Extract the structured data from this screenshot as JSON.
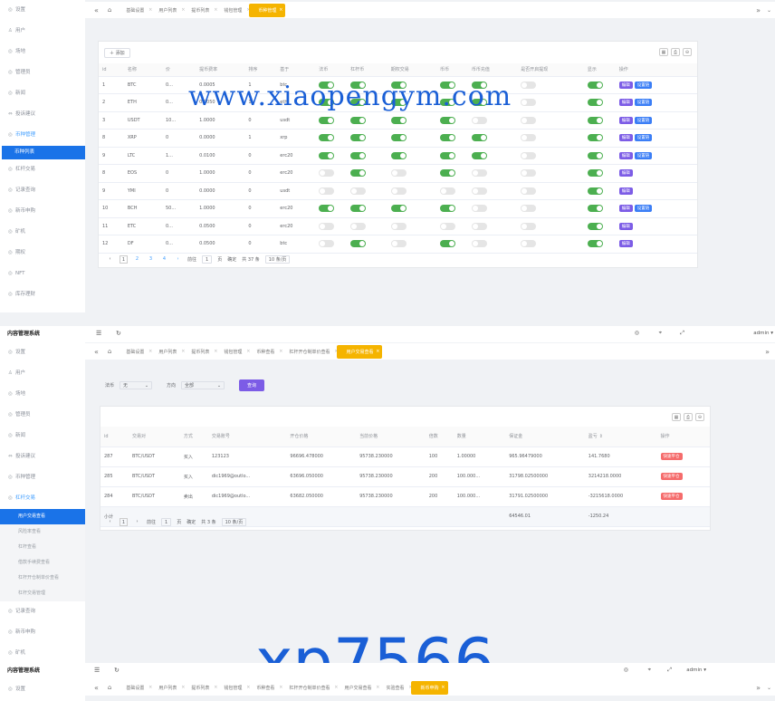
{
  "panel1": {
    "sidebar": [
      {
        "icon": "◎",
        "label": "设置"
      },
      {
        "icon": "♙",
        "label": "用户"
      },
      {
        "icon": "◎",
        "label": "场地"
      },
      {
        "icon": "◎",
        "label": "管理员"
      },
      {
        "icon": "◎",
        "label": "新闻"
      },
      {
        "icon": "⇔",
        "label": "投诉建议"
      },
      {
        "icon": "◎",
        "label": "币种管理",
        "active": true
      },
      {
        "icon": "",
        "label": "币种列表",
        "selected": true
      },
      {
        "icon": "◎",
        "label": "杠杆交易"
      },
      {
        "icon": "◎",
        "label": "记录查询"
      },
      {
        "icon": "◎",
        "label": "新币申购"
      },
      {
        "icon": "◎",
        "label": "矿机"
      },
      {
        "icon": "◎",
        "label": "期权"
      },
      {
        "icon": "◎",
        "label": "NFT"
      },
      {
        "icon": "◎",
        "label": "库存理财"
      }
    ],
    "tabs": [
      "基础设置",
      "用户列表",
      "提币列表",
      "钱包管理",
      "币种管理"
    ],
    "active_tab": 4,
    "add_label": "添加",
    "columns": [
      "id",
      "名称",
      "价",
      "提币费率",
      "排序",
      "基于",
      "法币",
      "杠杆币",
      "期权交易",
      "币币",
      "币币充值",
      "是否开启提现",
      "显示",
      "操作"
    ],
    "rows": [
      {
        "id": "1",
        "name": "BTC",
        "price": "0...",
        "fee": "0.0005",
        "sort": "1",
        "base": "btc",
        "sw": [
          1,
          1,
          1,
          1,
          1,
          0,
          1
        ],
        "actions": [
          "编辑",
          "设置链"
        ]
      },
      {
        "id": "2",
        "name": "ETH",
        "price": "0...",
        "fee": "0.0050",
        "sort": "1",
        "base": "eth",
        "sw": [
          1,
          1,
          1,
          1,
          1,
          0,
          1
        ],
        "actions": [
          "编辑",
          "设置链"
        ]
      },
      {
        "id": "3",
        "name": "USDT",
        "price": "10...",
        "fee": "1.0000",
        "sort": "0",
        "base": "usdt",
        "sw": [
          1,
          1,
          1,
          1,
          0,
          0,
          1
        ],
        "actions": [
          "编辑",
          "设置链"
        ]
      },
      {
        "id": "8",
        "name": "XRP",
        "price": "0",
        "fee": "0.0000",
        "sort": "1",
        "base": "xrp",
        "sw": [
          1,
          1,
          1,
          1,
          1,
          0,
          1
        ],
        "actions": [
          "编辑",
          "设置链"
        ]
      },
      {
        "id": "9",
        "name": "LTC",
        "price": "1...",
        "fee": "0.0100",
        "sort": "0",
        "base": "erc20",
        "sw": [
          1,
          1,
          1,
          1,
          1,
          0,
          1
        ],
        "actions": [
          "编辑",
          "设置链"
        ]
      },
      {
        "id": "8",
        "name": "EOS",
        "price": "0",
        "fee": "1.0000",
        "sort": "0",
        "base": "erc20",
        "sw": [
          0,
          1,
          0,
          1,
          0,
          0,
          1
        ],
        "actions": [
          "编辑"
        ]
      },
      {
        "id": "9",
        "name": "YMI",
        "price": "0",
        "fee": "0.0000",
        "sort": "0",
        "base": "usdt",
        "sw": [
          0,
          0,
          0,
          0,
          0,
          0,
          1
        ],
        "actions": [
          "编辑"
        ]
      },
      {
        "id": "10",
        "name": "BCH",
        "price": "50...",
        "fee": "1.0000",
        "sort": "0",
        "base": "erc20",
        "sw": [
          1,
          1,
          1,
          1,
          0,
          0,
          1
        ],
        "actions": [
          "编辑",
          "设置链"
        ]
      },
      {
        "id": "11",
        "name": "ETC",
        "price": "0...",
        "fee": "0.0500",
        "sort": "0",
        "base": "erc20",
        "sw": [
          0,
          0,
          0,
          0,
          0,
          0,
          1
        ],
        "actions": [
          "编辑"
        ]
      },
      {
        "id": "12",
        "name": "DF",
        "price": "0...",
        "fee": "0.0500",
        "sort": "0",
        "base": "btc",
        "sw": [
          0,
          1,
          0,
          1,
          0,
          0,
          1
        ],
        "actions": [
          "编辑"
        ]
      }
    ],
    "switch_on": "是",
    "switch_off": "否",
    "pager": {
      "pages": [
        "1",
        "2",
        "3",
        "4"
      ],
      "goto": "前往",
      "page_input": "1",
      "page_unit": "页",
      "confirm": "确定",
      "total": "共 37 条",
      "size": "10 条/页"
    }
  },
  "watermark1": "www.xiaopengym.com",
  "watermark2": "xp7566",
  "panel2": {
    "title": "内容管理系统",
    "admin": "admin",
    "sidebar": [
      {
        "icon": "◎",
        "label": "设置"
      },
      {
        "icon": "♙",
        "label": "用户"
      },
      {
        "icon": "◎",
        "label": "场地"
      },
      {
        "icon": "◎",
        "label": "管理员"
      },
      {
        "icon": "◎",
        "label": "新闻"
      },
      {
        "icon": "⇔",
        "label": "投诉建议"
      },
      {
        "icon": "◎",
        "label": "币种管理"
      },
      {
        "icon": "◎",
        "label": "杠杆交易",
        "active": true
      }
    ],
    "subitems": [
      {
        "label": "用户交易查看",
        "selected": true
      },
      {
        "label": "风险率查看"
      },
      {
        "label": "杠杆查看"
      },
      {
        "label": "借款手续费查看"
      },
      {
        "label": "杠杆开仓制单价查看"
      },
      {
        "label": "杠杆交易管理"
      }
    ],
    "sidebar_after": [
      {
        "icon": "◎",
        "label": "记录查询"
      },
      {
        "icon": "◎",
        "label": "新币申购"
      },
      {
        "icon": "◎",
        "label": "矿机"
      }
    ],
    "tabs": [
      "基础设置",
      "用户列表",
      "提币列表",
      "钱包管理",
      "币种查看",
      "杠杆开仓制单价查看",
      "用户交易查看"
    ],
    "active_tab": 6,
    "filter": {
      "coin_label": "法币",
      "coin_value": "无",
      "dir_label": "方向",
      "dir_value": "全部",
      "search_btn": "查询"
    },
    "columns": [
      "id",
      "交易对",
      "方式",
      "交易账号",
      "开仓价格",
      "当前价格",
      "倍数",
      "数量",
      "保证金",
      "盈亏",
      "操作"
    ],
    "sort_mark": "⇕",
    "rows": [
      {
        "id": "287",
        "pair": "BTC/USDT",
        "way": "买入",
        "account": "123123",
        "open": "96696.478000",
        "cur": "95738.230000",
        "mult": "100",
        "qty": "1.00000",
        "margin": "965.96479000",
        "pl": "141.7680",
        "action": "快速平仓"
      },
      {
        "id": "285",
        "pair": "BTC/USDT",
        "way": "买入",
        "account": "dic1969@outlo...",
        "open": "63696.050000",
        "cur": "95738.230000",
        "mult": "200",
        "qty": "100.000...",
        "margin": "31798.02500000",
        "pl": "3214218.0000",
        "action": "快速平仓"
      },
      {
        "id": "284",
        "pair": "BTC/USDT",
        "way": "卖出",
        "account": "dic1969@outlo...",
        "open": "63682.050000",
        "cur": "95738.230000",
        "mult": "200",
        "qty": "100.000...",
        "margin": "31791.02500000",
        "pl": "-3215618.0000",
        "action": "快速平仓"
      }
    ],
    "summary": {
      "label": "小计",
      "margin": "64546.01",
      "pl": "-1250.24"
    },
    "pager": {
      "page": "1",
      "goto": "前往",
      "page_input": "1",
      "page_unit": "页",
      "confirm": "确定",
      "total": "共 3 条",
      "size": "10 条/页"
    }
  },
  "panel3": {
    "title": "内容管理系统",
    "admin": "admin",
    "sidebar_first": "设置",
    "tabs": [
      "基础设置",
      "用户列表",
      "提币列表",
      "钱包管理",
      "币种查看",
      "杠杆开仓制单价查看",
      "用户交易查看",
      "实验查看",
      "新币申购"
    ],
    "active_tab": 8
  }
}
